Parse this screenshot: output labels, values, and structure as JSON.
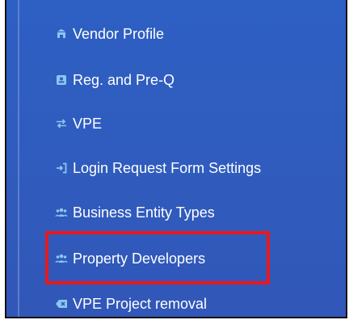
{
  "sidebar": {
    "items": [
      {
        "label": "Vendor Profile",
        "icon": "vendor-building-icon"
      },
      {
        "label": "Reg. and Pre-Q",
        "icon": "id-card-icon"
      },
      {
        "label": "VPE",
        "icon": "exchange-arrows-icon"
      },
      {
        "label": "Login Request Form Settings",
        "icon": "sign-in-icon"
      },
      {
        "label": "Business Entity Types",
        "icon": "users-icon"
      },
      {
        "label": "Property Developers",
        "icon": "users-icon",
        "highlighted": true
      },
      {
        "label": "VPE Project removal",
        "icon": "backspace-icon"
      }
    ]
  },
  "colors": {
    "sidebar_background": "#2f5dbf",
    "icon_color": "#8cc6f0",
    "highlight_border": "#e8191c"
  }
}
